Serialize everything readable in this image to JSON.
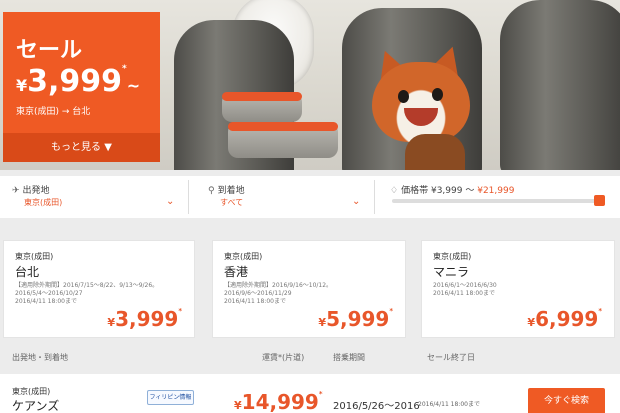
{
  "promo": {
    "title": "セール",
    "price_yen": "¥",
    "price_value": "3,999",
    "price_mark": "*",
    "price_tilde": "~",
    "route": "東京(成田) → 台北",
    "more_label": "もっと見る",
    "more_icon": "chevron-down-icon"
  },
  "search": {
    "origin": {
      "label": "出発地",
      "value": "東京(成田)",
      "icon": "plane-departure-icon"
    },
    "destination": {
      "label": "到着地",
      "value": "すべて",
      "icon": "location-pin-icon"
    },
    "price_range": {
      "label_prefix": "価格帯",
      "min": "¥3,999",
      "range_sep": "〜",
      "max": "¥21,999",
      "icon": "price-tag-icon",
      "slider_level_percent": 100
    }
  },
  "cards": [
    {
      "from": "東京(成田)",
      "to": "台北",
      "d1": "【適用除外期間】2016/7/15〜8/22、9/13〜9/26。",
      "d2": "2016/5/4〜2016/10/27",
      "d3": "2016/4/11 18:00まで",
      "yen": "¥",
      "price": "3,999",
      "mark": "*"
    },
    {
      "from": "東京(成田)",
      "to": "香港",
      "d1": "【適用除外期間】2016/9/16〜10/12。",
      "d2": "2016/9/6〜2016/11/29",
      "d3": "2016/4/11 18:00まで",
      "yen": "¥",
      "price": "5,999",
      "mark": "*"
    },
    {
      "from": "東京(成田)",
      "to": "マニラ",
      "d1": "2016/6/1〜2016/6/30",
      "d2": "2016/4/11 18:00まで",
      "d3": "",
      "yen": "¥",
      "price": "6,999",
      "mark": "*"
    }
  ],
  "table": {
    "headers": {
      "route": "出発地・到着地",
      "fare": "運賃*(片道)",
      "period": "搭乗期間",
      "end": "セール終了日"
    },
    "row": {
      "from": "東京(成田)",
      "to": "ケアンズ",
      "badge": "フィリピン情報",
      "yen": "¥",
      "price": "14,999",
      "mark": "*",
      "period": "2016/5/26〜2016",
      "end": "2016/4/11 18:00まで",
      "button": "今すぐ検索"
    }
  },
  "colors": {
    "accent": "#ef5a24",
    "accent_dark": "#d94a18",
    "price_text": "#e8562a"
  }
}
